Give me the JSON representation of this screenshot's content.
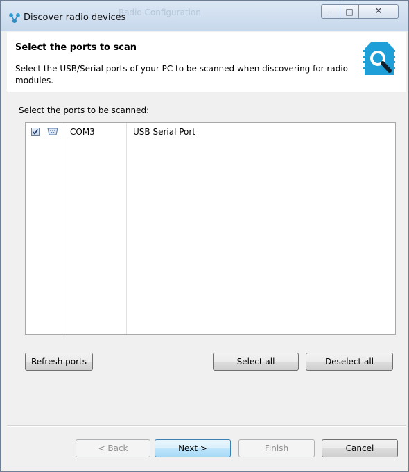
{
  "window": {
    "title": "Discover radio devices",
    "ghost_title": "Radio Configuration"
  },
  "titlebar_buttons": {
    "minimize": "–",
    "maximize": "□",
    "close": "✕"
  },
  "header": {
    "title": "Select the ports to scan",
    "description": "Select the USB/Serial ports of your PC to be scanned when discovering for radio modules."
  },
  "content": {
    "ports_label": "Select the ports to be scanned:",
    "ports": [
      {
        "checked": true,
        "port": "COM3",
        "description": "USB Serial Port",
        "icon": "serial-port-icon"
      }
    ]
  },
  "actions": {
    "refresh": "Refresh ports",
    "select_all": "Select all",
    "deselect_all": "Deselect all"
  },
  "wizard": {
    "back": "< Back",
    "next": "Next >",
    "finish": "Finish",
    "cancel": "Cancel"
  },
  "colors": {
    "accent": "#1f9fd8",
    "default_button": "#3c7fb1"
  }
}
